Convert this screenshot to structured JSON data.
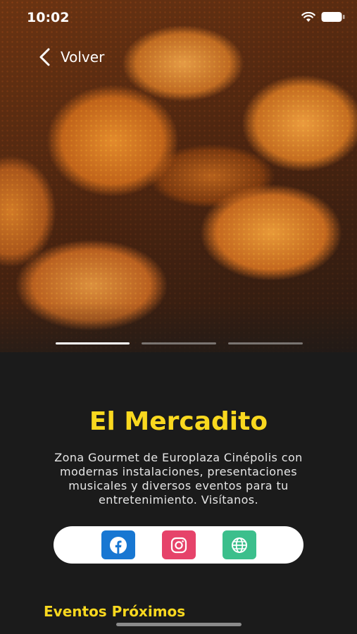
{
  "status_bar": {
    "time": "10:02"
  },
  "nav": {
    "back_label": "Volver"
  },
  "gallery": {
    "image_alt": "Pollo frito empanizado",
    "page_count": 3,
    "active_index": 0
  },
  "venue": {
    "name": "El Mercadito",
    "description": "Zona Gourmet de Europlaza Cinépolis con modernas instalaciones, presentaciones musicales y diversos eventos para tu entretenimiento. Visítanos."
  },
  "social": {
    "items": [
      {
        "icon": "facebook-icon",
        "color": "#1877d2"
      },
      {
        "icon": "instagram-icon",
        "color": "#e6436a"
      },
      {
        "icon": "globe-icon",
        "color": "#3cbf8c"
      }
    ]
  },
  "events": {
    "section_title": "Eventos Próximos"
  },
  "colors": {
    "accent": "#f9d81f",
    "background": "#1b1b1b"
  }
}
